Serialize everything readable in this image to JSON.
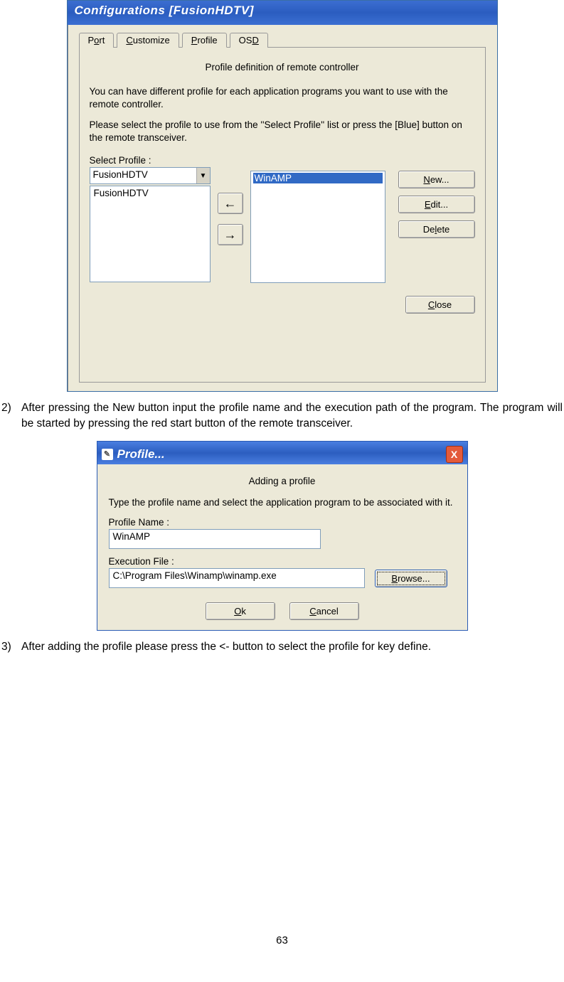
{
  "page_number": "63",
  "window1": {
    "title": "Configurations  [FusionHDTV]",
    "tabs": {
      "port": "Port",
      "customize": "Customize",
      "profile": "Profile",
      "osd": "OSD"
    },
    "panel_title": "Profile definition of remote controller",
    "para1": "You can have different profile for each application programs you want to use with the remote controller.",
    "para2": "Please select the profile to use from the ''Select Profile'' list or press the [Blue] button on the remote transceiver.",
    "select_label": "Select Profile :",
    "combo_value": "FusionHDTV",
    "left_list": [
      "FusionHDTV"
    ],
    "right_list": [
      "WinAMP"
    ],
    "buttons": {
      "new": "New...",
      "edit": "Edit...",
      "delete": "Delete",
      "close": "Close"
    },
    "arrow_left": "←",
    "arrow_right": "→",
    "combo_arrow": "▼"
  },
  "step2": {
    "num": "2)",
    "text": "After pressing the New button input the profile name and the execution path of the program. The program will be started by pressing the red start button of the remote transceiver."
  },
  "window2": {
    "title": "Profile...",
    "subtitle": "Adding a profile",
    "para": "Type the profile name and select the application program to be associated with it.",
    "name_label": "Profile Name :",
    "name_value": "WinAMP",
    "exec_label": "Execution File :",
    "exec_value": "C:\\Program Files\\Winamp\\winamp.exe",
    "browse": "Browse...",
    "ok": "Ok",
    "cancel": "Cancel",
    "close_x": "X",
    "icon": "✎"
  },
  "step3": {
    "num": "3)",
    "text": "After adding the profile please press the <- button to select the profile for key define."
  }
}
